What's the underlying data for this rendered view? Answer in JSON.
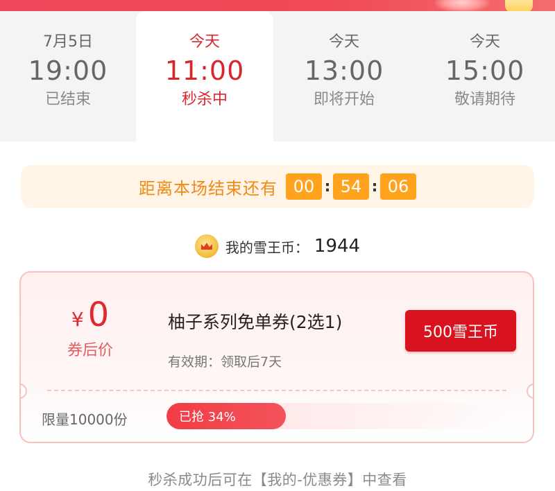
{
  "tabs": [
    {
      "day": "7月5日",
      "time": "19:00",
      "status": "已结束",
      "active": false
    },
    {
      "day": "今天",
      "time": "11:00",
      "status": "秒杀中",
      "active": true
    },
    {
      "day": "今天",
      "time": "13:00",
      "status": "即将开始",
      "active": false
    },
    {
      "day": "今天",
      "time": "15:00",
      "status": "敬请期待",
      "active": false
    }
  ],
  "countdown": {
    "label": "距离本场结束还有",
    "hours": "00",
    "minutes": "54",
    "seconds": "06",
    "separator": ":"
  },
  "balance": {
    "icon": "coin-icon",
    "label": "我的雪王币：",
    "value": "1944"
  },
  "coupon": {
    "currency": "¥",
    "price": "0",
    "price_label": "券后价",
    "title": "柚子系列免单券(2选1)",
    "validity": "有效期：领取后7天",
    "button_label": "500雪王币",
    "limit": "限量10000份",
    "progress_label": "已抢 34%",
    "progress_percent": 34
  },
  "footer": {
    "note": "秒杀成功后可在【我的-优惠券】中查看"
  },
  "colors": {
    "accent_red": "#d8262c",
    "button_red": "#d8121e",
    "countdown_orange": "#ffa21c",
    "countdown_bg": "#fff4e6"
  }
}
